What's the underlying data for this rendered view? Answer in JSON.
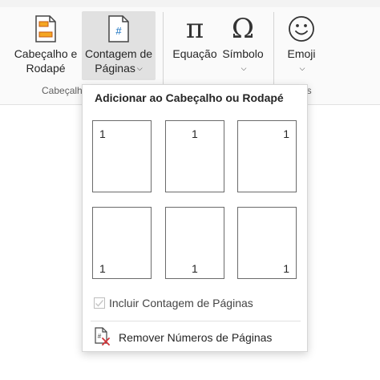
{
  "ribbon": {
    "buttons": {
      "header_footer": {
        "line1": "Cabeçalho e",
        "line2": "Rodapé",
        "icon": "header-footer-icon"
      },
      "page_count": {
        "line1": "Contagem de",
        "line2": "Páginas",
        "icon": "page-number-icon",
        "icon_glyph": "#"
      },
      "equation": {
        "label": "Equação",
        "icon": "pi-icon",
        "glyph": "π"
      },
      "symbol": {
        "label": "Símbolo",
        "icon": "omega-icon",
        "glyph": "Ω"
      },
      "emoji": {
        "label": "Emoji",
        "icon": "smiley-icon"
      }
    },
    "groups": {
      "header_footer_group": "Cabeçalho",
      "emoji_group_partial": "is"
    },
    "accent_orange": "#c55a11",
    "accent_blue": "#0f6cbd"
  },
  "dropdown": {
    "title": "Adicionar ao Cabeçalho ou Rodapé",
    "positions": [
      {
        "name": "top-left",
        "number": "1"
      },
      {
        "name": "top-center",
        "number": "1"
      },
      {
        "name": "top-right",
        "number": "1"
      },
      {
        "name": "bottom-left",
        "number": "1"
      },
      {
        "name": "bottom-center",
        "number": "1"
      },
      {
        "name": "bottom-right",
        "number": "1"
      }
    ],
    "include_page_count": {
      "label": "Incluir Contagem de Páginas",
      "checked": true,
      "enabled": false
    },
    "remove": {
      "label": "Remover Números de Páginas",
      "icon": "remove-page-numbers-icon"
    }
  }
}
